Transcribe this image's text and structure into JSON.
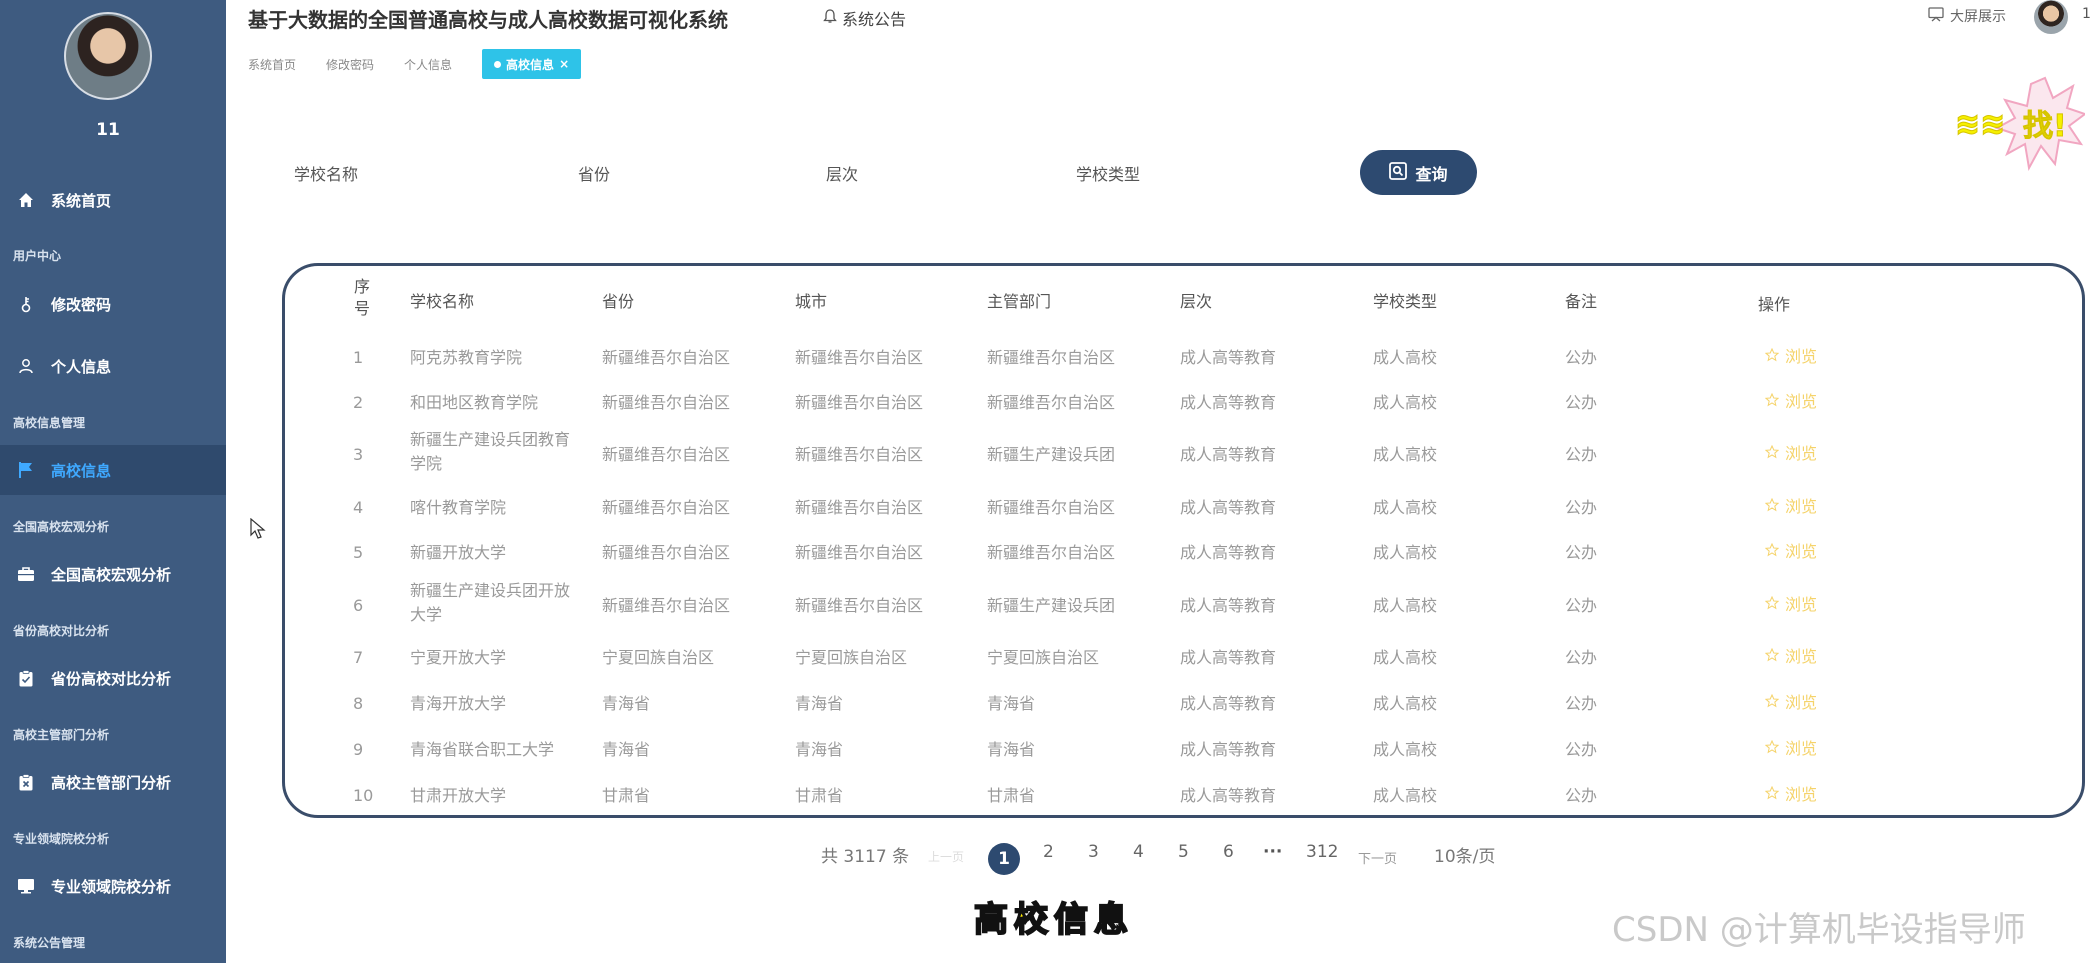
{
  "sidebar": {
    "user_name": "11",
    "items": [
      {
        "label": "系统首页"
      },
      {
        "group": "用户中心"
      },
      {
        "label": "修改密码"
      },
      {
        "label": "个人信息"
      },
      {
        "group": "高校信息管理"
      },
      {
        "label": "高校信息"
      },
      {
        "group": "全国高校宏观分析"
      },
      {
        "label": "全国高校宏观分析"
      },
      {
        "group": "省份高校对比分析"
      },
      {
        "label": "省份高校对比分析"
      },
      {
        "group": "高校主管部门分析"
      },
      {
        "label": "高校主管部门分析"
      },
      {
        "group": "专业领域院校分析"
      },
      {
        "label": "专业领域院校分析"
      },
      {
        "group": "系统公告管理"
      }
    ]
  },
  "header": {
    "title": "基于大数据的全国普通高校与成人高校数据可视化系统",
    "notice": "系统公告",
    "bigscreen": "大屏展示",
    "user_short": "1"
  },
  "breadcrumbs": {
    "items": [
      "系统首页",
      "修改密码",
      "个人信息"
    ],
    "active": "高校信息",
    "close": "×"
  },
  "search": {
    "school_name": "学校名称",
    "province": "省份",
    "level": "层次",
    "school_type": "学校类型",
    "button": "查询"
  },
  "table": {
    "columns": [
      "序号",
      "学校名称",
      "省份",
      "城市",
      "主管部门",
      "层次",
      "学校类型",
      "备注",
      "操作"
    ],
    "action_label": "浏览",
    "rows": [
      {
        "no": "1",
        "name": "阿克苏教育学院",
        "province": "新疆维吾尔自治区",
        "city": "新疆维吾尔自治区",
        "dept": "新疆维吾尔自治区",
        "level": "成人高等教育",
        "type": "成人高校",
        "note": "公办"
      },
      {
        "no": "2",
        "name": "和田地区教育学院",
        "province": "新疆维吾尔自治区",
        "city": "新疆维吾尔自治区",
        "dept": "新疆维吾尔自治区",
        "level": "成人高等教育",
        "type": "成人高校",
        "note": "公办"
      },
      {
        "no": "3",
        "name": "新疆生产建设兵团教育学院",
        "province": "新疆维吾尔自治区",
        "city": "新疆维吾尔自治区",
        "dept": "新疆生产建设兵团",
        "level": "成人高等教育",
        "type": "成人高校",
        "note": "公办"
      },
      {
        "no": "4",
        "name": "喀什教育学院",
        "province": "新疆维吾尔自治区",
        "city": "新疆维吾尔自治区",
        "dept": "新疆维吾尔自治区",
        "level": "成人高等教育",
        "type": "成人高校",
        "note": "公办"
      },
      {
        "no": "5",
        "name": "新疆开放大学",
        "province": "新疆维吾尔自治区",
        "city": "新疆维吾尔自治区",
        "dept": "新疆维吾尔自治区",
        "level": "成人高等教育",
        "type": "成人高校",
        "note": "公办"
      },
      {
        "no": "6",
        "name": "新疆生产建设兵团开放大学",
        "province": "新疆维吾尔自治区",
        "city": "新疆维吾尔自治区",
        "dept": "新疆生产建设兵团",
        "level": "成人高等教育",
        "type": "成人高校",
        "note": "公办"
      },
      {
        "no": "7",
        "name": "宁夏开放大学",
        "province": "宁夏回族自治区",
        "city": "宁夏回族自治区",
        "dept": "宁夏回族自治区",
        "level": "成人高等教育",
        "type": "成人高校",
        "note": "公办"
      },
      {
        "no": "8",
        "name": "青海开放大学",
        "province": "青海省",
        "city": "青海省",
        "dept": "青海省",
        "level": "成人高等教育",
        "type": "成人高校",
        "note": "公办"
      },
      {
        "no": "9",
        "name": "青海省联合职工大学",
        "province": "青海省",
        "city": "青海省",
        "dept": "青海省",
        "level": "成人高等教育",
        "type": "成人高校",
        "note": "公办"
      },
      {
        "no": "10",
        "name": "甘肃开放大学",
        "province": "甘肃省",
        "city": "甘肃省",
        "dept": "甘肃省",
        "level": "成人高等教育",
        "type": "成人高校",
        "note": "公办"
      }
    ]
  },
  "pagination": {
    "total": "共 3117 条",
    "prev": "上一页",
    "current": "1",
    "pages": [
      "2",
      "3",
      "4",
      "5",
      "6"
    ],
    "ellipsis": "···",
    "last": "312",
    "next": "下一页",
    "page_size": "10条/页"
  },
  "overlay": {
    "caption": "高校信息",
    "watermark": "CSDN @计算机毕设指导师",
    "sticker_text": "找!"
  },
  "colors": {
    "sidebar": "#3e5b80",
    "active_menu_text": "#3fa9ff",
    "primary_button": "#2d4a70",
    "tab_active": "#2ec3e8",
    "browse_link": "#f5d36a"
  }
}
